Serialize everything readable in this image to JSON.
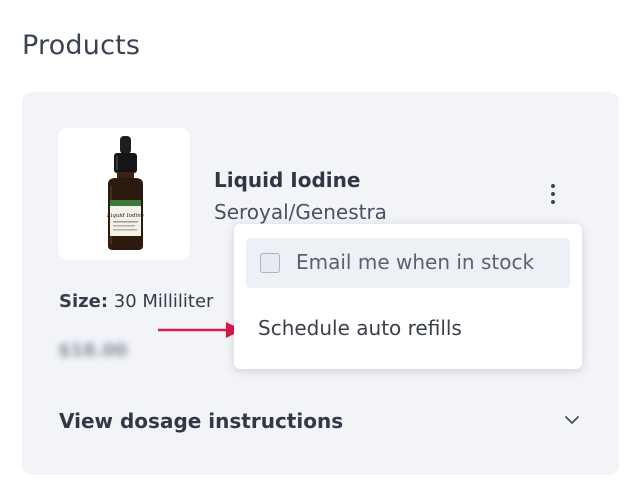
{
  "page": {
    "title": "Products"
  },
  "product": {
    "name": "Liquid Iodine",
    "brand": "Seroyal/Genestra",
    "size_label": "Size:",
    "size_value": "30 Milliliter",
    "price": "$18.00",
    "image_label": "Liquid Iodine"
  },
  "dosage": {
    "label": "View dosage instructions"
  },
  "menu": {
    "items": [
      {
        "label": "Email me when in stock",
        "checked": false
      },
      {
        "label": "Schedule auto refills"
      }
    ]
  },
  "annotation": {
    "arrow_color": "#d81b4a"
  }
}
